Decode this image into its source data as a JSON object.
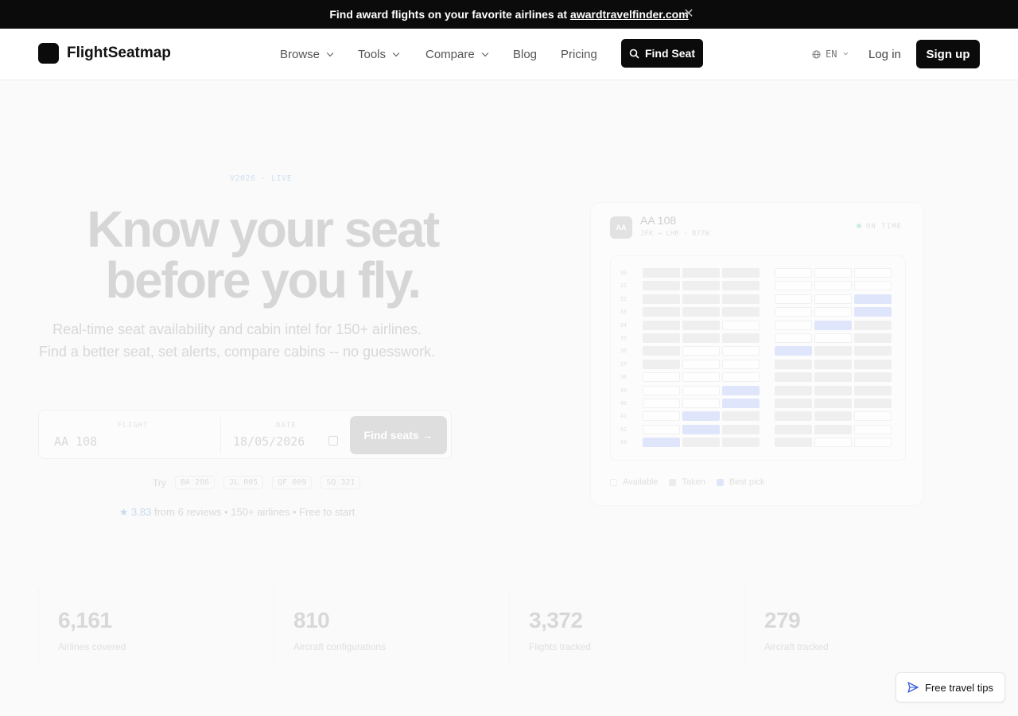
{
  "banner": {
    "text": "Find award flights on your favorite airlines at",
    "link": "awardtravelfinder.com",
    "close": "✕"
  },
  "nav": {
    "brand": "FlightSeatmap",
    "items": [
      "Browse",
      "Tools",
      "Compare",
      "Blog",
      "Pricing"
    ],
    "find_seat": "Find Seat",
    "language": "EN",
    "login": "Log in",
    "signup": "Sign up"
  },
  "hero": {
    "badge": "V2026 · LIVE",
    "title_line1": "Know your seat",
    "title_line2": "before you fly.",
    "subtitle": "Real-time seat availability and cabin intel for 150+ airlines. Find a better seat, set alerts, compare cabins -- no guesswork.",
    "flight_label": "FLIGHT",
    "flight_value": "AA 108",
    "date_label": "DATE",
    "date_value": "18/05/2026",
    "submit": "Find seats →",
    "try_label": "Try",
    "try_chips": [
      "BA 286",
      "JL 005",
      "QF 009",
      "SQ 321"
    ],
    "rating_star": "★",
    "rating_score": "3.83",
    "rating_rest": "from 6 reviews • 150+ airlines • Free to start"
  },
  "seatmap": {
    "airline_code": "AA",
    "flight": "AA 108",
    "route": "JFK → LHR · B77W",
    "status": "ON TIME",
    "status_color": "#cdeee0",
    "best_color": "#dfe6fb",
    "rows": [
      {
        "num": "30",
        "seats": [
          "t",
          "t",
          "t",
          "a",
          "a",
          "a"
        ]
      },
      {
        "num": "31",
        "seats": [
          "t",
          "t",
          "t",
          "a",
          "a",
          "a"
        ]
      },
      {
        "num": "32",
        "seats": [
          "t",
          "t",
          "t",
          "a",
          "a",
          "b"
        ]
      },
      {
        "num": "33",
        "seats": [
          "t",
          "t",
          "t",
          "a",
          "a",
          "b"
        ]
      },
      {
        "num": "34",
        "seats": [
          "t",
          "t",
          "a",
          "a",
          "b",
          "t"
        ]
      },
      {
        "num": "35",
        "seats": [
          "t",
          "t",
          "t",
          "a",
          "a",
          "t"
        ]
      },
      {
        "num": "36",
        "seats": [
          "t",
          "a",
          "a",
          "b",
          "t",
          "t"
        ]
      },
      {
        "num": "37",
        "seats": [
          "t",
          "a",
          "a",
          "t",
          "t",
          "t"
        ]
      },
      {
        "num": "38",
        "seats": [
          "a",
          "a",
          "a",
          "t",
          "t",
          "t"
        ]
      },
      {
        "num": "39",
        "seats": [
          "a",
          "a",
          "b",
          "t",
          "t",
          "t"
        ]
      },
      {
        "num": "40",
        "seats": [
          "a",
          "a",
          "b",
          "t",
          "t",
          "t"
        ]
      },
      {
        "num": "41",
        "seats": [
          "a",
          "b",
          "t",
          "t",
          "t",
          "a"
        ]
      },
      {
        "num": "42",
        "seats": [
          "a",
          "b",
          "t",
          "t",
          "t",
          "a"
        ]
      },
      {
        "num": "43",
        "seats": [
          "b",
          "t",
          "t",
          "t",
          "a",
          "a"
        ]
      }
    ],
    "legend": [
      "Available",
      "Taken",
      "Best pick"
    ]
  },
  "stats": [
    {
      "value": "6,161",
      "label": "Airlines covered"
    },
    {
      "value": "810",
      "label": "Aircraft configurations"
    },
    {
      "value": "3,372",
      "label": "Flights tracked"
    },
    {
      "value": "279",
      "label": "Aircraft tracked"
    }
  ],
  "tips": "Free travel tips"
}
